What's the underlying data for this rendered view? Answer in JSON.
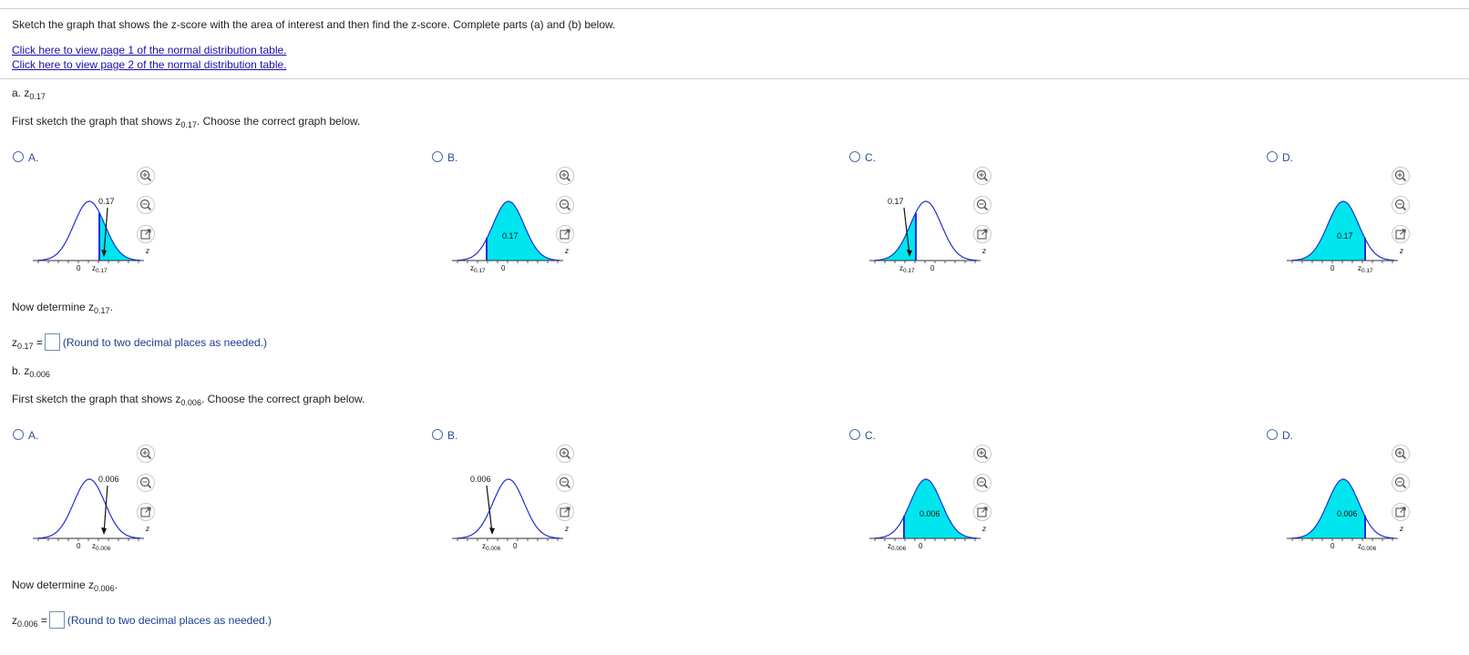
{
  "question": {
    "instructions": "Sketch the graph that shows the z-score with the area of interest and then find the z-score. Complete parts (a) and (b) below.",
    "link1": "Click here to view page 1 of the normal distribution table.",
    "link2": "Click here to view page 2 of the normal distribution table."
  },
  "partA": {
    "label_prefix": "a.",
    "z_main": "z",
    "z_sub": "0.17",
    "sketch_prompt_pre": "First sketch the graph that shows z",
    "sketch_prompt_post": ". Choose the correct graph below.",
    "determine_pre": "Now determine z",
    "determine_post": ".",
    "answer_eq": "=",
    "answer_hint": "(Round to two decimal places as needed.)",
    "options": [
      {
        "label": "A.",
        "area_label": "0.17",
        "zero_label": "0",
        "z_label": "z",
        "z_sub": "0.17",
        "axis_z": "z"
      },
      {
        "label": "B.",
        "area_label": "0.17",
        "zero_label": "0",
        "z_label": "z",
        "z_sub": "0.17",
        "axis_z": "z"
      },
      {
        "label": "C.",
        "area_label": "0.17",
        "zero_label": "0",
        "z_label": "z",
        "z_sub": "0.17",
        "axis_z": "z"
      },
      {
        "label": "D.",
        "area_label": "0.17",
        "zero_label": "0",
        "z_label": "z",
        "z_sub": "0.17",
        "axis_z": "z"
      }
    ]
  },
  "partB": {
    "label_prefix": "b.",
    "z_main": "z",
    "z_sub": "0.006",
    "sketch_prompt_pre": "First sketch the graph that shows z",
    "sketch_prompt_post": ". Choose the correct graph below.",
    "determine_pre": "Now determine z",
    "determine_post": ".",
    "answer_eq": "=",
    "answer_hint": "(Round to two decimal places as needed.)",
    "options": [
      {
        "label": "A.",
        "area_label": "0.006",
        "zero_label": "0",
        "z_label": "z",
        "z_sub": "0.006",
        "axis_z": "z"
      },
      {
        "label": "B.",
        "area_label": "0.006",
        "zero_label": "0",
        "z_label": "z",
        "z_sub": "0.006",
        "axis_z": "z"
      },
      {
        "label": "C.",
        "area_label": "0.006",
        "zero_label": "0",
        "z_label": "z",
        "z_sub": "0.006",
        "axis_z": "z"
      },
      {
        "label": "D.",
        "area_label": "0.006",
        "zero_label": "0",
        "z_label": "z",
        "z_sub": "0.006",
        "axis_z": "z"
      }
    ]
  },
  "colors": {
    "curve": "#1f2fd6",
    "fill": "#00e5ee",
    "link": "#1a0dab"
  },
  "icons": [
    "zoom-in-icon",
    "zoom-out-icon",
    "popout-icon"
  ]
}
